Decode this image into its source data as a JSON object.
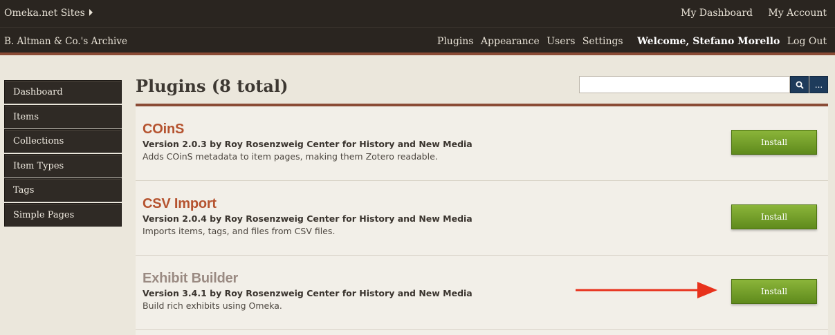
{
  "topbar": {
    "sites_label": "Omeka.net Sites",
    "dashboard_link": "My Dashboard",
    "account_link": "My Account"
  },
  "secbar": {
    "archive_name": "B. Altman & Co.'s Archive",
    "nav": [
      "Plugins",
      "Appearance",
      "Users",
      "Settings"
    ],
    "welcome": "Welcome, Stefano Morello",
    "logout": "Log Out"
  },
  "sidebar": {
    "items": [
      "Dashboard",
      "Items",
      "Collections",
      "Item Types",
      "Tags",
      "Simple Pages"
    ]
  },
  "page": {
    "title": "Plugins (8 total)"
  },
  "search": {
    "value": "",
    "more_label": "..."
  },
  "plugins": [
    {
      "name": "COinS",
      "version": "Version 2.0.3 by Roy Rosenzweig Center for History and New Media",
      "description": "Adds COinS metadata to item pages, making them Zotero readable.",
      "button": "Install"
    },
    {
      "name": "CSV Import",
      "version": "Version 2.0.4 by Roy Rosenzweig Center for History and New Media",
      "description": "Imports items, tags, and files from CSV files.",
      "button": "Install"
    },
    {
      "name": "Exhibit Builder",
      "version": "Version 3.4.1 by Roy Rosenzweig Center for History and New Media",
      "description": "Build rich exhibits using Omeka.",
      "button": "Install"
    }
  ],
  "colors": {
    "accent": "#8a4b35",
    "plugin_title": "#b5532f",
    "install_button": "#6f9a23",
    "annotation_arrow": "#e8321c"
  },
  "icons": {
    "search": "search-icon",
    "annotation": "red-arrow-icon"
  }
}
